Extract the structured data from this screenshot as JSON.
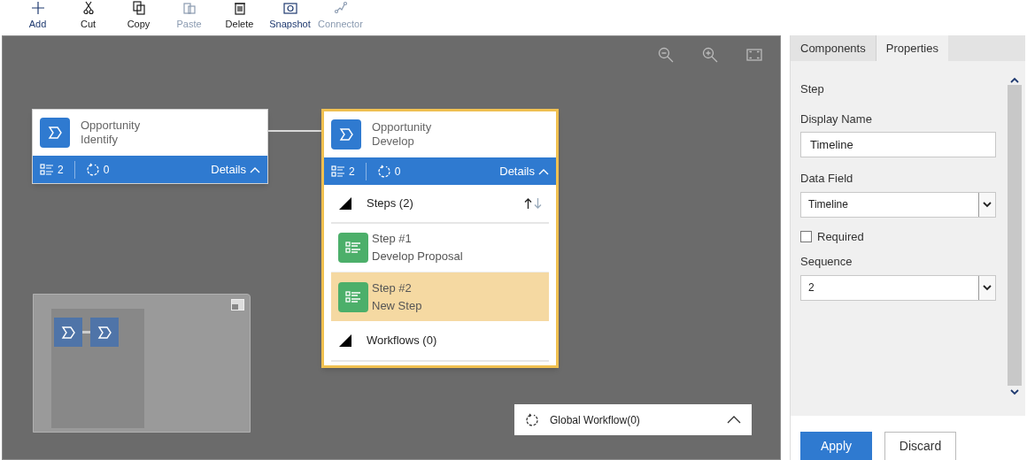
{
  "toolbar": [
    {
      "label": "Add",
      "disabled": false,
      "kind": "add"
    },
    {
      "label": "Cut",
      "disabled": false,
      "kind": "cut"
    },
    {
      "label": "Copy",
      "disabled": false,
      "kind": "copy"
    },
    {
      "label": "Paste",
      "disabled": true,
      "kind": "paste"
    },
    {
      "label": "Delete",
      "disabled": false,
      "kind": "delete"
    },
    {
      "label": "Snapshot",
      "disabled": false,
      "kind": "snapshot"
    },
    {
      "label": "Connector",
      "disabled": true,
      "kind": "connector"
    }
  ],
  "canvas": {
    "stages": [
      {
        "entity": "Opportunity",
        "name": "Identify",
        "steps_count": "2",
        "workflows_count": "0",
        "details_label": "Details",
        "selected": false
      },
      {
        "entity": "Opportunity",
        "name": "Develop",
        "steps_count": "2",
        "workflows_count": "0",
        "details_label": "Details",
        "selected": true,
        "steps_section": {
          "title": "Steps (2)",
          "items": [
            {
              "title": "Step #1",
              "name": "Develop Proposal",
              "selected": false
            },
            {
              "title": "Step #2",
              "name": "New Step",
              "selected": true
            }
          ]
        },
        "workflows_section": {
          "title": "Workflows (0)"
        }
      }
    ],
    "global_workflow": {
      "label": "Global Workflow(0)"
    }
  },
  "panel": {
    "tabs": [
      {
        "label": "Components",
        "selected": false
      },
      {
        "label": "Properties",
        "selected": true
      }
    ],
    "heading": "Step",
    "display_name": {
      "label": "Display Name",
      "value": "Timeline"
    },
    "data_field": {
      "label": "Data Field",
      "value": "Timeline"
    },
    "required": {
      "label": "Required",
      "checked": false
    },
    "sequence": {
      "label": "Sequence",
      "value": "2"
    },
    "buttons": [
      {
        "label": "Apply",
        "kind": "primary"
      },
      {
        "label": "Discard",
        "kind": "secondary"
      }
    ]
  }
}
